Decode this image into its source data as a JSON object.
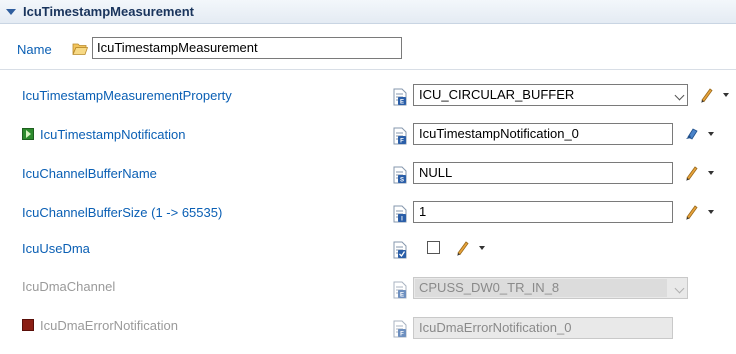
{
  "section": {
    "title": "IcuTimestampMeasurement"
  },
  "name": {
    "label": "Name",
    "value": "IcuTimestampMeasurement"
  },
  "rows": [
    {
      "label": "IcuTimestampMeasurementProperty",
      "value": "ICU_CIRCULAR_BUFFER"
    },
    {
      "label": "IcuTimestampNotification",
      "value": "IcuTimestampNotification_0"
    },
    {
      "label": "IcuChannelBufferName",
      "value": "NULL"
    },
    {
      "label": "IcuChannelBufferSize (1 -> 65535)",
      "value": "1"
    },
    {
      "label": "IcuUseDma",
      "checked": false
    },
    {
      "label": "IcuDmaChannel",
      "value": "CPUSS_DW0_TR_IN_8"
    },
    {
      "label": "IcuDmaErrorNotification",
      "value": "IcuDmaErrorNotification_0"
    }
  ],
  "icons": {
    "twisty": "expand-arrow-icon",
    "folder": "folder-open-icon",
    "doc": "document-parameter-icon",
    "edit": "pencil-icon",
    "reference": "reference-link-icon",
    "dropdown": "dropdown-arrow-icon"
  },
  "colors": {
    "label": "#0a5fb4",
    "disabled_label": "#9a9a9a",
    "header_bg": "#e4ebf3",
    "pencil": "#e8a33b"
  }
}
